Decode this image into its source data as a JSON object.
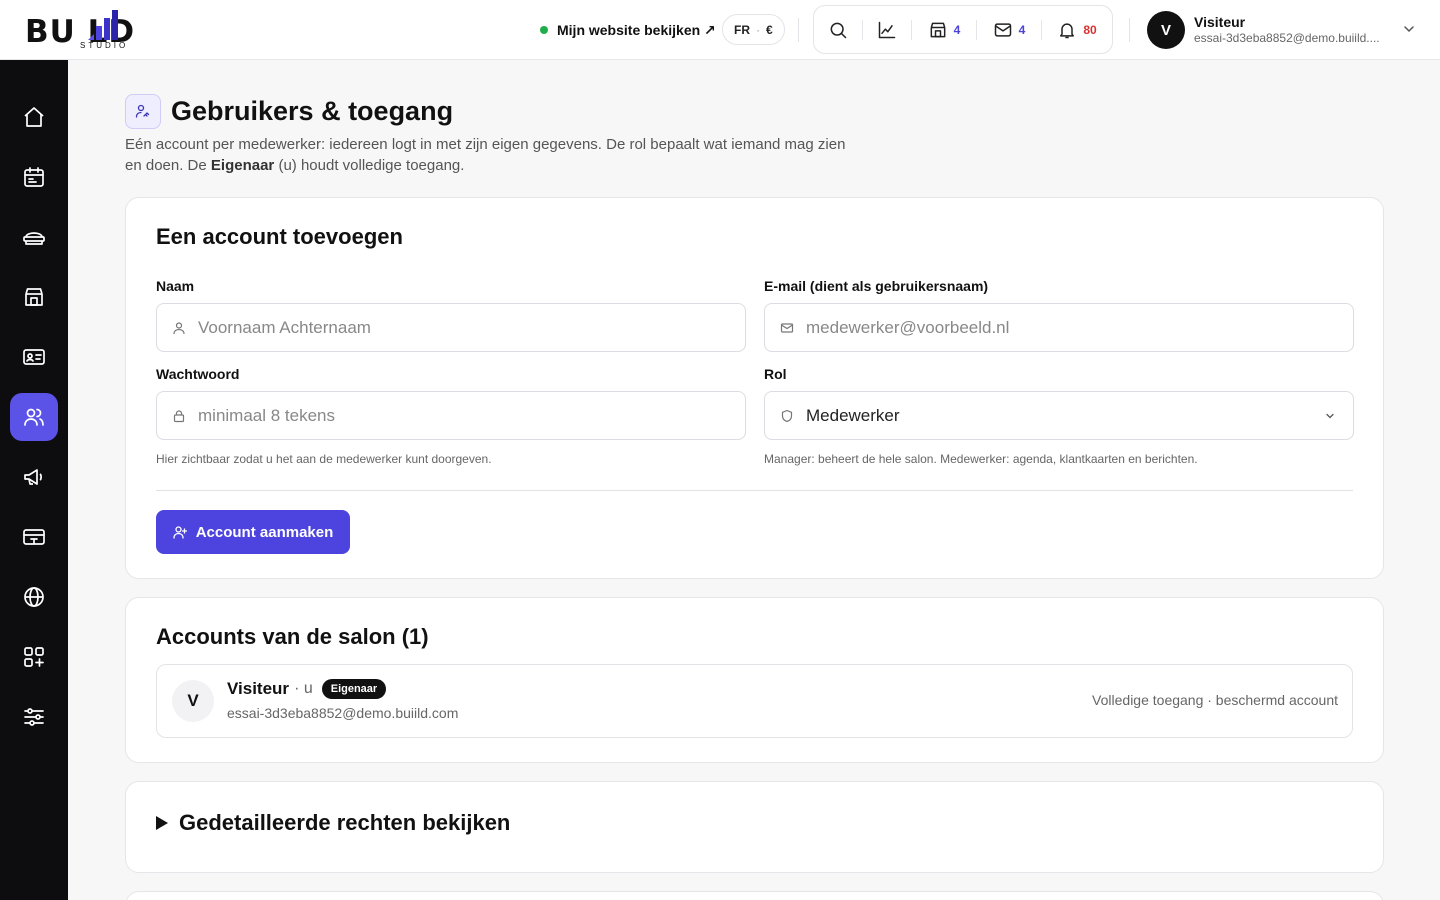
{
  "brand": {
    "logo_main": "BU  LD",
    "logo_sub": "STUDIO"
  },
  "header": {
    "site_link": "Mijn website bekijken ↗",
    "lang": "FR",
    "currency": "€",
    "tools": [
      {
        "icon": "search-icon"
      },
      {
        "icon": "chart-icon"
      },
      {
        "icon": "store-icon",
        "count": "4"
      },
      {
        "icon": "mail-icon",
        "count": "4"
      },
      {
        "icon": "bell-icon",
        "count": "80"
      }
    ],
    "user": {
      "initial": "V",
      "name": "Visiteur",
      "email": "essai-3d3eba8852@demo.buiild...."
    }
  },
  "sidebar": {
    "items": [
      {
        "icon": "home-icon"
      },
      {
        "icon": "calendar-icon"
      },
      {
        "icon": "service-icon"
      },
      {
        "icon": "store-icon"
      },
      {
        "icon": "id-card-icon"
      },
      {
        "icon": "users-icon",
        "active": true
      },
      {
        "icon": "megaphone-icon"
      },
      {
        "icon": "payment-icon"
      },
      {
        "icon": "globe-icon"
      },
      {
        "icon": "apps-icon"
      },
      {
        "icon": "sliders-icon"
      }
    ]
  },
  "page": {
    "title": "Gebruikers & toegang",
    "intro_part1": "Eén account per medewerker: iedereen logt in met zijn eigen gegevens. De rol bepaalt wat iemand mag zien en doen. De ",
    "intro_bold": "Eigenaar",
    "intro_part2": " (u) houdt volledige toegang."
  },
  "add_account": {
    "heading": "Een account toevoegen",
    "name_label": "Naam",
    "name_placeholder": "Voornaam Achternaam",
    "email_label": "E-mail (dient als gebruikersnaam)",
    "email_placeholder": "medewerker@voorbeeld.nl",
    "password_label": "Wachtwoord",
    "password_placeholder": "minimaal 8 tekens",
    "password_hint": "Hier zichtbaar zodat u het aan de medewerker kunt doorgeven.",
    "role_label": "Rol",
    "role_value": "Medewerker",
    "role_hint": "Manager: beheert de hele salon. Medewerker: agenda, klantkaarten en berichten.",
    "submit_label": "Account aanmaken"
  },
  "accounts": {
    "heading": "Accounts van de salon (1)",
    "items": [
      {
        "initial": "V",
        "name": "Visiteur",
        "you": "· u",
        "badge": "Eigenaar",
        "email": "essai-3d3eba8852@demo.buiild.com",
        "status": "Volledige toegang · beschermd account"
      }
    ]
  },
  "details": {
    "label": "Gedetailleerde rechten bekijken"
  },
  "colors": {
    "accent": "#4d44e0",
    "active_nav": "#5b52e8",
    "status_green": "#1fae4b",
    "alert_red": "#d6322f",
    "sidebar_bg": "#0d0d0f"
  }
}
